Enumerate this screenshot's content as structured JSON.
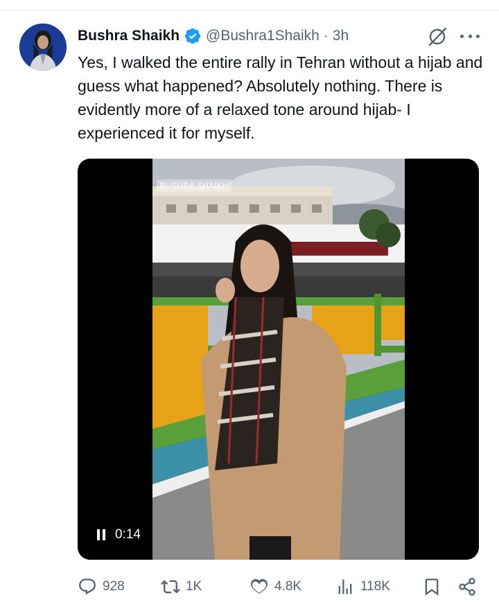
{
  "tweet": {
    "author_name": "Bushra Shaikh",
    "handle": "@Bushra1Shaikh",
    "separator": "·",
    "time": "3h",
    "text": "Yes, I walked the entire rally in Tehran without a hijab and guess what happened? Absolutely nothing. There is evidently more of a relaxed tone around hijab- I experienced it for myself."
  },
  "media": {
    "watermark": "BUSHRA SHAIKH",
    "elapsed": "0:14"
  },
  "actions": {
    "replies": "928",
    "reposts": "1K",
    "likes": "4.8K",
    "views": "118K"
  },
  "icons": {
    "verified": "verified-badge-icon",
    "grok": "grok-icon",
    "more": "more-icon",
    "reply": "reply-icon",
    "repost": "repost-icon",
    "like": "heart-icon",
    "views": "views-icon",
    "bookmark": "bookmark-icon",
    "share": "share-icon",
    "pause": "pause-icon"
  },
  "colors": {
    "text": "#0f1419",
    "secondary": "#536471",
    "verified": "#1d9bf0"
  }
}
